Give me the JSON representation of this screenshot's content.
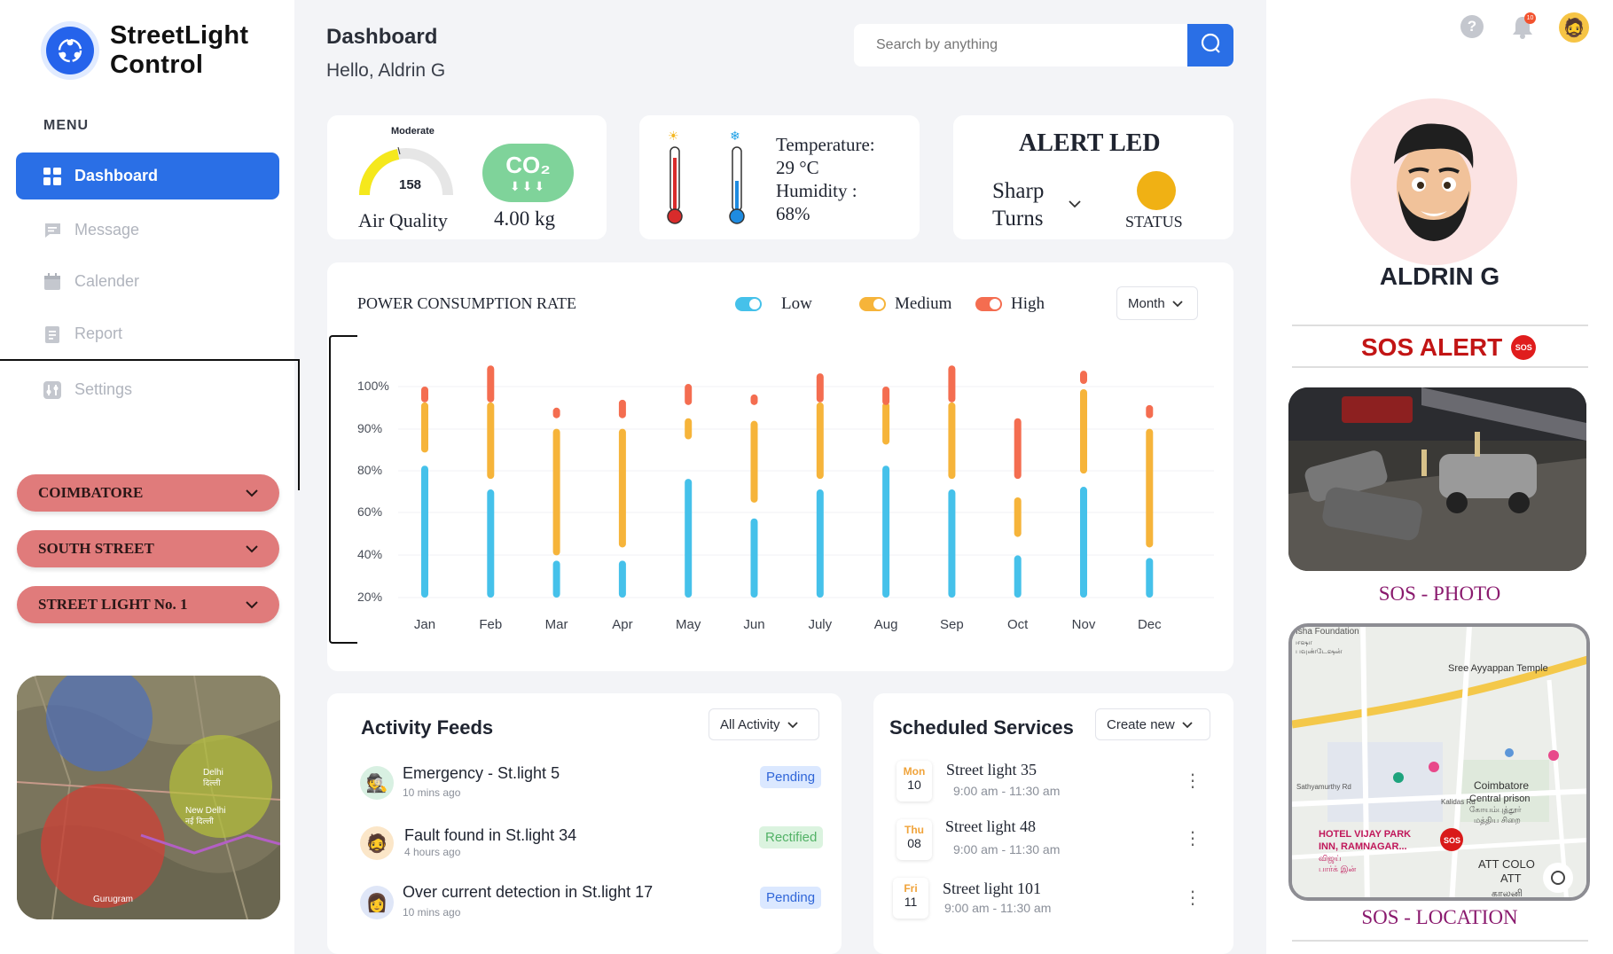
{
  "brand": {
    "line1": "StreetLight",
    "line2": "Control"
  },
  "sidebar": {
    "menu_label": "MENU",
    "items": [
      {
        "label": "Dashboard",
        "icon": "grid-icon",
        "active": true
      },
      {
        "label": "Message",
        "icon": "message-icon",
        "active": false
      },
      {
        "label": "Calender",
        "icon": "calendar-icon",
        "active": false
      },
      {
        "label": "Report",
        "icon": "report-icon",
        "active": false
      },
      {
        "label": "Settings",
        "icon": "settings-icon",
        "active": false
      }
    ],
    "selects": [
      {
        "value": "COIMBATORE"
      },
      {
        "value": "SOUTH STREET"
      },
      {
        "value": "STREET LIGHT No. 1"
      }
    ],
    "map_labels": {
      "delhi": "Delhi",
      "delhi_hi": "दिल्ली",
      "new_delhi": "New Delhi",
      "new_delhi_hi": "नई दिल्ली",
      "gurugram": "Gurugram"
    }
  },
  "header": {
    "title": "Dashboard",
    "greeting": "Hello, Aldrin G",
    "search_placeholder": "Search by anything"
  },
  "air_quality": {
    "level_label": "Moderate",
    "value": "158",
    "label": "Air Quality",
    "co2_value": "4.00 kg",
    "co2_text": "CO₂"
  },
  "weather": {
    "temperature_line": "Temperature:",
    "temperature_value": "29 °C",
    "humidity_line": "Humidity :",
    "humidity_value": "68%"
  },
  "alert_led": {
    "title": "ALERT LED",
    "mode_line1": "Sharp",
    "mode_line2": "Turns",
    "status_label": "STATUS",
    "status_color": "#f0b114"
  },
  "power_chart": {
    "title": "POWER CONSUMPTION RATE",
    "legend": [
      {
        "label": "Low",
        "color": "#45c1ea"
      },
      {
        "label": "Medium",
        "color": "#f6b43a"
      },
      {
        "label": "High",
        "color": "#f46d50"
      }
    ],
    "period": "Month"
  },
  "chart_data": {
    "type": "bar",
    "title": "POWER CONSUMPTION RATE",
    "categories": [
      "Jan",
      "Feb",
      "Mar",
      "Apr",
      "May",
      "Jun",
      "July",
      "Aug",
      "Sep",
      "Oct",
      "Nov",
      "Dec"
    ],
    "y_ticks": [
      "100%",
      "90%",
      "80%",
      "60%",
      "40%",
      "20%"
    ],
    "ylim": [
      20,
      106
    ],
    "series": [
      {
        "name": "Low",
        "color": "#45c1ea",
        "ranges": [
          [
            20,
            70
          ],
          [
            20,
            61
          ],
          [
            20,
            34
          ],
          [
            20,
            34
          ],
          [
            20,
            65
          ],
          [
            20,
            50
          ],
          [
            20,
            61
          ],
          [
            20,
            70
          ],
          [
            20,
            61
          ],
          [
            20,
            36
          ],
          [
            20,
            62
          ],
          [
            20,
            35
          ]
        ]
      },
      {
        "name": "Medium",
        "color": "#f6b43a",
        "ranges": [
          [
            75,
            94
          ],
          [
            65,
            94
          ],
          [
            36,
            84
          ],
          [
            39,
            84
          ],
          [
            80,
            88
          ],
          [
            56,
            87
          ],
          [
            65,
            94
          ],
          [
            78,
            94
          ],
          [
            65,
            94
          ],
          [
            43,
            58
          ],
          [
            67,
            99
          ],
          [
            39,
            84
          ]
        ]
      },
      {
        "name": "High",
        "color": "#f46d50",
        "ranges": [
          [
            94,
            100
          ],
          [
            94,
            108
          ],
          [
            88,
            92
          ],
          [
            88,
            95
          ],
          [
            93,
            101
          ],
          [
            93,
            97
          ],
          [
            94,
            105
          ],
          [
            93,
            100
          ],
          [
            94,
            108
          ],
          [
            65,
            88
          ],
          [
            101,
            106
          ],
          [
            88,
            93
          ]
        ]
      }
    ]
  },
  "activity": {
    "title": "Activity Feeds",
    "filter": "All Activity",
    "items": [
      {
        "title": "Emergency - St.light 5",
        "time": "10 mins ago",
        "status": "Pending",
        "kind": "pending"
      },
      {
        "title": "Fault found in St.light 34",
        "time": "4 hours ago",
        "status": "Rectified",
        "kind": "rect"
      },
      {
        "title": "Over current detection in St.light 17",
        "time": "10 mins ago",
        "status": "Pending",
        "kind": "pending"
      }
    ]
  },
  "scheduled": {
    "title": "Scheduled Services",
    "action": "Create new",
    "items": [
      {
        "day": "Mon",
        "date": "10",
        "title": "Street light 35",
        "time": "9:00 am - 11:30 am"
      },
      {
        "day": "Thu",
        "date": "08",
        "title": "Street light 48",
        "time": "9:00 am - 11:30 am"
      },
      {
        "day": "Fri",
        "date": "11",
        "title": "Street light 101",
        "time": "9:00 am - 11:30 am"
      }
    ]
  },
  "profile": {
    "name": "ALDRIN G",
    "sos_alert": "SOS ALERT",
    "sos_badge": "SOS",
    "sos_photo": "SOS - PHOTO",
    "sos_location": "SOS - LOCATION",
    "notification_count": "10"
  },
  "map": {
    "labels": {
      "isha": "Isha Foundation",
      "isha_ta": "ஈஷா",
      "isha_ta2": "பவுண்டேஷன்",
      "temple": "Sree Ayyappan Temple",
      "coimbatore": "Coimbatore",
      "prison": "Central prison",
      "prison_ta1": "கோயம்புத்தூர்",
      "prison_ta2": "மத்திய சிறை",
      "hotel1": "HOTEL VIJAY PARK",
      "hotel2": "INN, RAMNAGAR...",
      "hotel_ta1": "விஜய்",
      "hotel_ta2": "பார்க் இன்",
      "road": "Sathyamurthy Rd",
      "road2": "Kalidas Rd",
      "att1": "ATT COLO",
      "att2": "ATT",
      "att_ta": "காலனி"
    }
  }
}
